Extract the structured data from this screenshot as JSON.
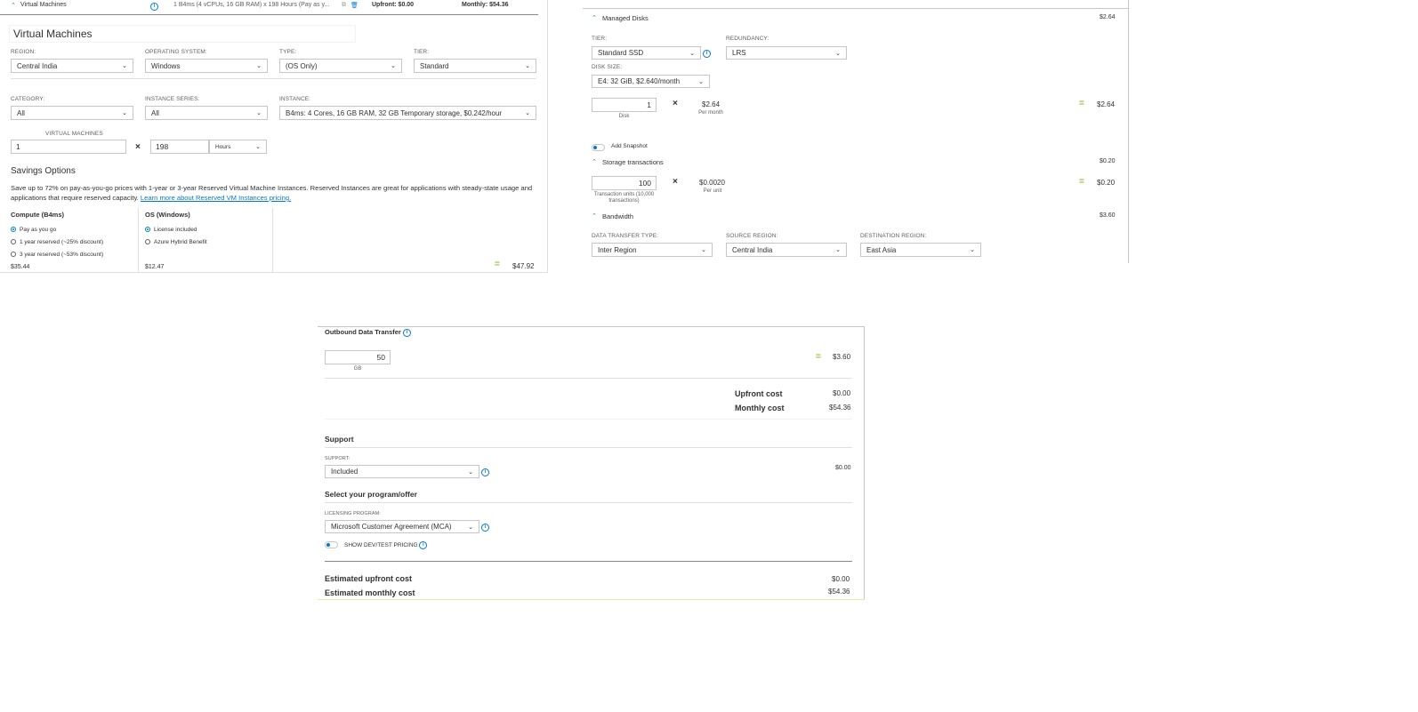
{
  "vm_summary": {
    "title": "Virtual Machines",
    "description": "1 B4ms (4 vCPUs, 16 GB RAM) x 198 Hours (Pay as y...",
    "upfront": "Upfront: $0.00",
    "monthly": "Monthly: $54.36"
  },
  "vm": {
    "heading": "Virtual Machines",
    "region": {
      "label": "REGION:",
      "value": "Central India"
    },
    "os": {
      "label": "OPERATING SYSTEM:",
      "value": "Windows"
    },
    "type": {
      "label": "TYPE:",
      "value": "(OS Only)"
    },
    "tier": {
      "label": "TIER:",
      "value": "Standard"
    },
    "category": {
      "label": "CATEGORY:",
      "value": "All"
    },
    "series": {
      "label": "INSTANCE SERIES:",
      "value": "All"
    },
    "instance": {
      "label": "INSTANCE:",
      "value": "B4ms: 4 Cores, 16 GB RAM, 32 GB Temporary storage, $0.242/hour"
    },
    "count": {
      "label": "VIRTUAL MACHINES",
      "value": "1"
    },
    "hours": {
      "value": "198",
      "unit": "Hours"
    },
    "savings": {
      "heading": "Savings Options",
      "text": "Save up to 72% on pay-as-you-go prices with 1-year or 3-year Reserved Virtual Machine Instances. Reserved Instances are great for applications with steady-state usage and applications that require reserved capacity.",
      "link": "Learn more about Reserved VM Instances pricing."
    },
    "compute": {
      "heading": "Compute (B4ms)",
      "options": [
        "Pay as you go",
        "1 year reserved (~25% discount)",
        "3 year reserved (~53% discount)"
      ],
      "price": "$35.44"
    },
    "os_license": {
      "heading": "OS (Windows)",
      "options": [
        "License included",
        "Azure Hybrid Benefit"
      ],
      "price": "$12.47"
    },
    "total": "$47.92"
  },
  "disks": {
    "heading": "Managed Disks",
    "price": "$2.64",
    "tier": {
      "label": "TIER:",
      "value": "Standard SSD"
    },
    "redundancy": {
      "label": "REDUNDANCY:",
      "value": "LRS"
    },
    "size": {
      "label": "DISK SIZE:",
      "value": "E4: 32 GiB, $2.640/month"
    },
    "count": "1",
    "count_unit": "Disk",
    "unit_price": "$2.64",
    "unit_price_label": "Per month",
    "total": "$2.64",
    "snapshot": "Add Snapshot"
  },
  "transactions": {
    "heading": "Storage transactions",
    "price": "$0.20",
    "count": "100",
    "count_unit": "Transaction units (10,000 transactions)",
    "unit_price": "$0.0020",
    "unit_price_label": "Per unit",
    "total": "$0.20"
  },
  "bandwidth": {
    "heading": "Bandwidth",
    "price": "$3.60",
    "type": {
      "label": "DATA TRANSFER TYPE:",
      "value": "Inter Region"
    },
    "source": {
      "label": "SOURCE REGION:",
      "value": "Central India"
    },
    "dest": {
      "label": "DESTINATION REGION:",
      "value": "East Asia"
    }
  },
  "outbound": {
    "heading": "Outbound Data Transfer",
    "value": "50",
    "unit": "GB",
    "total": "$3.60"
  },
  "costs": {
    "upfront_label": "Upfront cost",
    "upfront": "$0.00",
    "monthly_label": "Monthly cost",
    "monthly": "$54.36"
  },
  "support": {
    "heading": "Support",
    "label": "SUPPORT:",
    "value": "Included",
    "price": "$0.00"
  },
  "program": {
    "heading": "Select your program/offer",
    "label": "LICENSING PROGRAM:",
    "value": "Microsoft Customer Agreement (MCA)",
    "devtest": "SHOW DEV/TEST PRICING"
  },
  "estimate": {
    "upfront_label": "Estimated upfront cost",
    "upfront": "$0.00",
    "monthly_label": "Estimated monthly cost",
    "monthly": "$54.36"
  },
  "icons": {
    "chevron": "chevron-down-icon",
    "info": "info-icon",
    "copy": "copy-icon",
    "delete": "trash-icon"
  },
  "colors": {
    "accent": "#0078d4",
    "equals": "#8dc63f",
    "border": "#c8c6c4"
  }
}
